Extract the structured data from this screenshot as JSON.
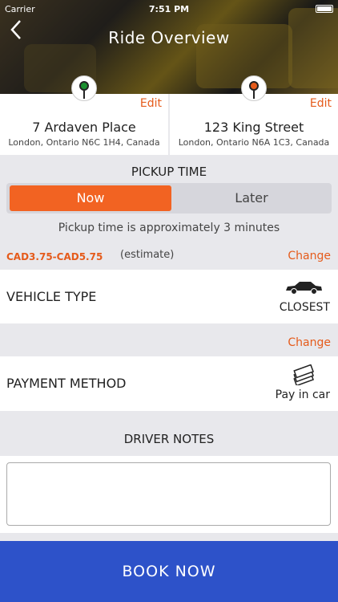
{
  "status_bar": {
    "carrier": "Carrier",
    "time": "7:51 PM"
  },
  "header": {
    "title": "Ride Overview",
    "back_icon": "chevron-left-icon"
  },
  "pickup_address": {
    "edit_label": "Edit",
    "street": "7 Ardaven Place",
    "city": "London, Ontario N6C 1H4, Canada",
    "pin_color": "#1a8f2e"
  },
  "dropoff_address": {
    "edit_label": "Edit",
    "street": "123 King Street",
    "city": "London, Ontario N6A 1C3, Canada",
    "pin_color": "#e55b1b"
  },
  "pickup_time": {
    "label": "PICKUP TIME",
    "options": [
      "Now",
      "Later"
    ],
    "selected": "Now",
    "approx_text": "Pickup time is approximately 3 minutes"
  },
  "fare": {
    "range": "CAD3.75-CAD5.75",
    "estimate_label": "(estimate)",
    "change_label": "Change"
  },
  "vehicle": {
    "label": "VEHICLE TYPE",
    "value": "CLOSEST",
    "icon": "car-icon"
  },
  "payment": {
    "change_label": "Change",
    "label": "PAYMENT METHOD",
    "value": "Pay in car",
    "icon": "money-icon"
  },
  "driver_notes": {
    "label": "DRIVER NOTES",
    "value": ""
  },
  "book_button": {
    "label": "BOOK NOW"
  },
  "colors": {
    "accent": "#f26322",
    "book": "#2d52c9"
  }
}
